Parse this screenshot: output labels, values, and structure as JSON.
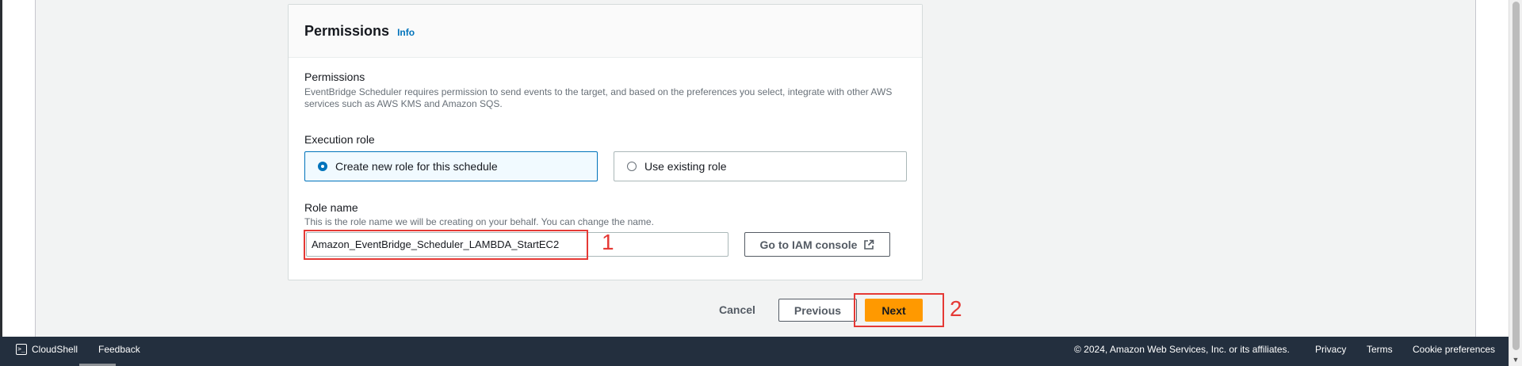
{
  "panel": {
    "title": "Permissions",
    "info_link": "Info"
  },
  "permissions": {
    "label": "Permissions",
    "description_line1": "EventBridge Scheduler requires permission to send events to the target, and based on the preferences you select, integrate with other AWS",
    "description_line2": "services such as AWS KMS and Amazon SQS."
  },
  "execution_role": {
    "label": "Execution role",
    "options": [
      {
        "label": "Create new role for this schedule",
        "selected": true
      },
      {
        "label": "Use existing role",
        "selected": false
      }
    ]
  },
  "role_name": {
    "label": "Role name",
    "description": "This is the role name we will be creating on your behalf. You can change the name.",
    "value": "Amazon_EventBridge_Scheduler_LAMBDA_StartEC2",
    "iam_button": "Go to IAM console"
  },
  "actions": {
    "cancel": "Cancel",
    "previous": "Previous",
    "next": "Next"
  },
  "annotations": {
    "one": "1",
    "two": "2"
  },
  "footer": {
    "cloudshell": "CloudShell",
    "feedback": "Feedback",
    "copyright": "© 2024, Amazon Web Services, Inc. or its affiliates.",
    "privacy": "Privacy",
    "terms": "Terms",
    "cookie_preferences": "Cookie preferences"
  },
  "colors": {
    "accent": "#0073bb",
    "primary_button": "#ff9900",
    "annotation": "#e53935",
    "footer_bg": "#232f3e"
  }
}
